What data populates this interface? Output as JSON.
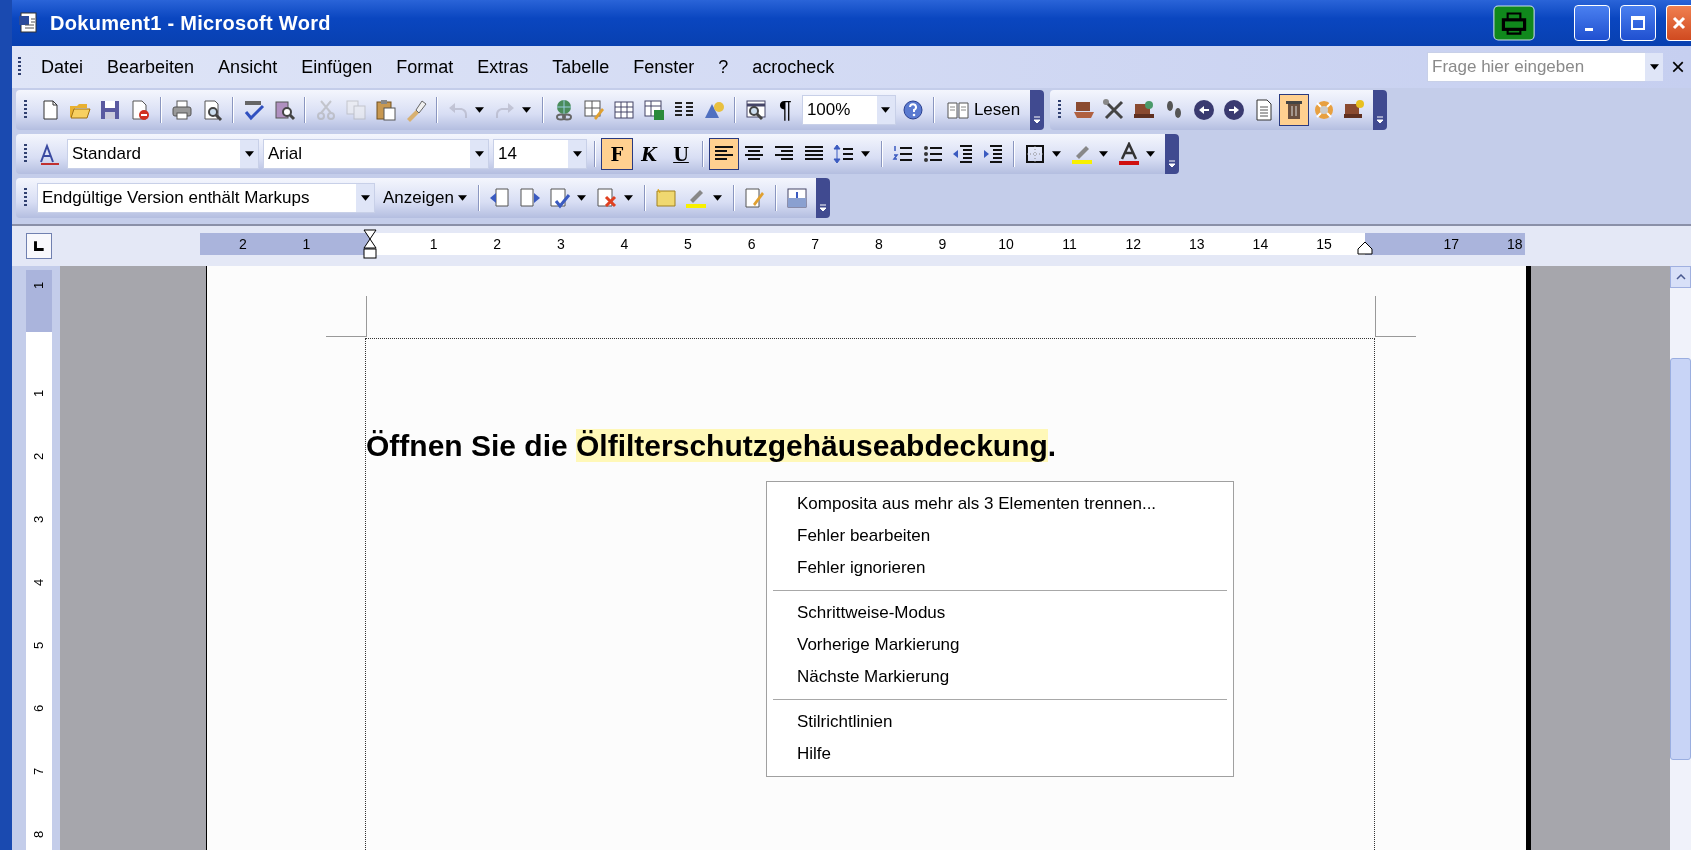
{
  "window": {
    "title": "Dokument1 - Microsoft Word"
  },
  "menu": [
    {
      "label": "Datei"
    },
    {
      "label": "Bearbeiten"
    },
    {
      "label": "Ansicht"
    },
    {
      "label": "Einfügen"
    },
    {
      "label": "Format"
    },
    {
      "label": "Extras"
    },
    {
      "label": "Tabelle"
    },
    {
      "label": "Fenster"
    },
    {
      "label": "?"
    },
    {
      "label": "acrocheck"
    }
  ],
  "help_box": {
    "placeholder": "Frage hier eingeben"
  },
  "close_glyph": "×",
  "standard_toolbar": {
    "pilcrow": "¶",
    "zoom": "100%",
    "read_button": "Lesen"
  },
  "extra_toolbar": {
    "buttons": [
      {
        "selected": false
      },
      {
        "selected": false
      },
      {
        "selected": false
      },
      {
        "selected": false
      },
      {
        "selected": false
      },
      {
        "selected": false
      },
      {
        "selected": false
      },
      {
        "selected": true
      },
      {
        "selected": false
      },
      {
        "selected": false
      }
    ]
  },
  "format_toolbar": {
    "style": "Standard",
    "font": "Arial",
    "size": "14",
    "format_buttons": [
      {
        "label": "F",
        "on": true
      },
      {
        "label": "K",
        "on": false
      },
      {
        "label": "U",
        "on": false
      }
    ],
    "alignment": [
      {
        "on": true
      },
      {
        "on": false
      },
      {
        "on": false
      },
      {
        "on": false
      }
    ]
  },
  "review_toolbar": {
    "display": "Endgültige Version enthält Markups",
    "show_button": "Anzeigen"
  },
  "ruler": {
    "left_labels": [
      "2",
      "1"
    ],
    "labels": [
      "1",
      "2",
      "3",
      "4",
      "5",
      "6",
      "7",
      "8",
      "9",
      "10",
      "11",
      "12",
      "13",
      "14",
      "15"
    ],
    "right_labels": [
      "17",
      "18"
    ]
  },
  "vertical_ruler": {
    "top_labels": [
      "1"
    ],
    "labels": [
      "1",
      "2",
      "3",
      "4",
      "5",
      "6",
      "7",
      "8"
    ]
  },
  "document": {
    "paragraph": [
      {
        "text": "Öffnen Sie die ",
        "highlight": false
      },
      {
        "text": "Ölfilterschutzgehäuseabdeckung",
        "highlight": true
      },
      {
        "text": ".",
        "highlight": false
      }
    ]
  },
  "context_menu": {
    "groups": [
      [
        "Komposita aus mehr als 3 Elementen trennen...",
        "Fehler bearbeiten",
        "Fehler ignorieren"
      ],
      [
        "Schrittweise-Modus",
        "Vorherige Markierung",
        "Nächste Markierung"
      ],
      [
        "Stilrichtlinien",
        "Hilfe"
      ]
    ]
  }
}
